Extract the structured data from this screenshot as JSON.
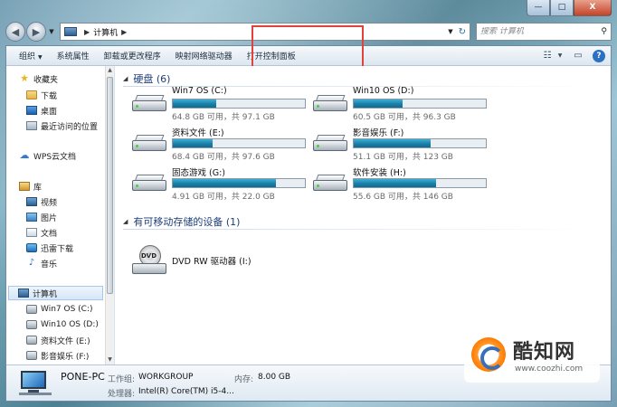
{
  "window": {
    "caption_buttons": {
      "minimize": "—",
      "maximize": "□",
      "close": "X"
    }
  },
  "nav": {
    "back_glyph": "◀",
    "forward_glyph": "▶",
    "dropdown_glyph": "▼",
    "address": {
      "crumb_separator": "▶",
      "crumb": "计算机",
      "trailing_separator": "▶",
      "refresh_glyph": "↻"
    },
    "search_placeholder": "搜索 计算机",
    "search_icon": "⚲"
  },
  "toolbar": {
    "organize": "组织",
    "organize_caret": "▼",
    "system_properties": "系统属性",
    "uninstall": "卸载或更改程序",
    "map_drive": "映射网络驱动器",
    "open_control_panel": "打开控制面板",
    "view_icon": "☷",
    "view_caret": "▼",
    "preview_icon": "▭",
    "help_icon": "?",
    "highlight_color": "#e0433b"
  },
  "sidebar": {
    "favorites": "收藏夹",
    "downloads": "下载",
    "desktop": "桌面",
    "recent": "最近访问的位置",
    "wps_cloud": "WPS云文档",
    "libraries": "库",
    "videos": "视频",
    "pictures": "图片",
    "documents": "文档",
    "thunder": "迅雷下载",
    "music": "音乐",
    "computer": "计算机",
    "drive_c": "Win7 OS (C:)",
    "drive_d": "Win10 OS (D:)",
    "drive_e": "资料文件 (E:)",
    "drive_f": "影音娱乐 (F:)",
    "icons": {
      "star": "★",
      "cloud": "☁",
      "music": "♪"
    },
    "scroll_up": "▲",
    "scroll_down": "▼"
  },
  "main": {
    "hard_disks": {
      "title": "硬盘 (6)",
      "toggle": "◢"
    },
    "removable": {
      "title": "有可移动存储的设备 (1)",
      "toggle": "◢"
    },
    "drives": [
      {
        "name": "Win7 OS (C:)",
        "size": "64.8 GB 可用，共 97.1 GB",
        "used": 0.33
      },
      {
        "name": "Win10 OS (D:)",
        "size": "60.5 GB 可用，共 96.3 GB",
        "used": 0.37
      },
      {
        "name": "资料文件 (E:)",
        "size": "68.4 GB 可用，共 97.6 GB",
        "used": 0.3
      },
      {
        "name": "影音娱乐 (F:)",
        "size": "51.1 GB 可用，共 123 GB",
        "used": 0.58
      },
      {
        "name": "固态游戏 (G:)",
        "size": "4.91 GB 可用，共 22.0 GB",
        "used": 0.78
      },
      {
        "name": "软件安装 (H:)",
        "size": "55.6 GB 可用，共 146 GB",
        "used": 0.62
      }
    ],
    "dvd": {
      "label": "DVD",
      "name": "DVD RW 驱动器 (I:)"
    }
  },
  "details": {
    "pc_name": "PONE-PC",
    "workgroup_label": "工作组:",
    "workgroup_value": "WORKGROUP",
    "memory_label": "内存:",
    "memory_value": "8.00 GB",
    "cpu_label": "处理器:",
    "cpu_value": "Intel(R) Core(TM) i5-4..."
  },
  "watermark": {
    "title": "酷知网",
    "url": "www.coozhi.com"
  }
}
